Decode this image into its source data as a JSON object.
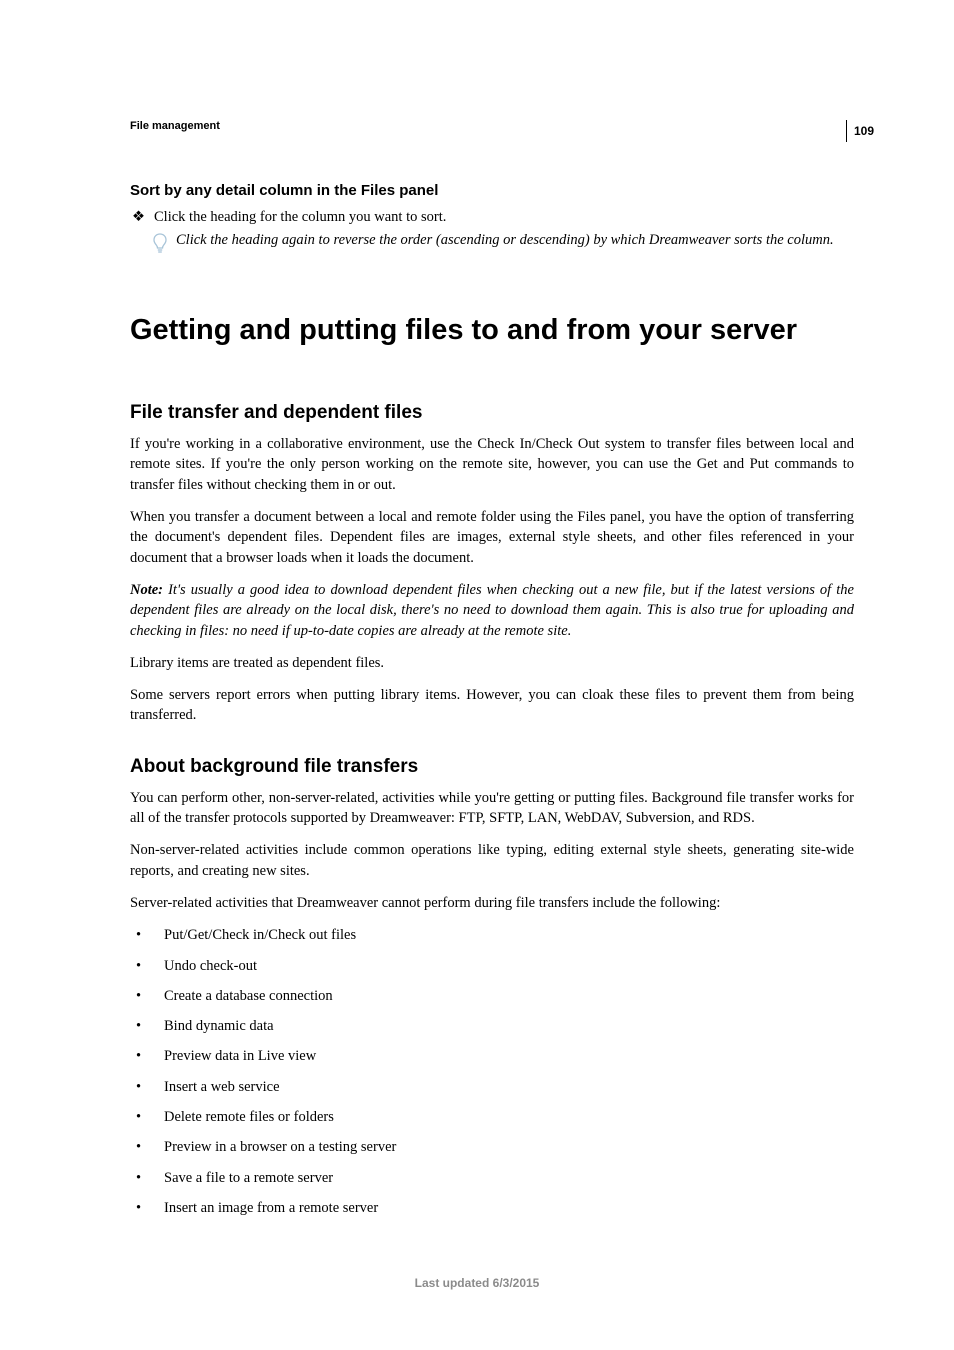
{
  "page_number": "109",
  "running_head": "File management",
  "section_sort": {
    "heading": "Sort by any detail column in the Files panel",
    "bullet": "Click the heading for the column you want to sort.",
    "tip": "Click the heading again to reverse the order (ascending or descending) by which Dreamweaver sorts the column."
  },
  "main_heading": "Getting and putting files to and from your server",
  "section_transfer": {
    "heading": "File transfer and dependent files",
    "p1": "If you're working in a collaborative environment, use the Check In/Check Out system to transfer files between local and remote sites. If you're the only person working on the remote site, however, you can use the Get and Put commands to transfer files without checking them in or out.",
    "p2": "When you transfer a document between a local and remote folder using the Files panel, you have the option of transferring the document's dependent files. Dependent files are images, external style sheets, and other files referenced in your document that a browser loads when it loads the document.",
    "note_label": "Note: ",
    "note_text": "It's usually a good idea to download dependent files when checking out a new file, but if the latest versions of the dependent files are already on the local disk, there's no need to download them again. This is also true for uploading and checking in files: no need if up-to-date copies are already at the remote site.",
    "p3": "Library items are treated as dependent files.",
    "p4": "Some servers report errors when putting library items. However, you can cloak these files to prevent them from being transferred."
  },
  "section_background": {
    "heading": "About background file transfers",
    "p1": "You can perform other, non-server-related, activities while you're getting or putting files. Background file transfer works for all of the transfer protocols supported by Dreamweaver: FTP, SFTP, LAN, WebDAV, Subversion, and RDS.",
    "p2": "Non-server-related activities include common operations like typing, editing external style sheets, generating site-wide reports, and creating new sites.",
    "p3": "Server-related activities that Dreamweaver cannot perform during file transfers include the following:",
    "items": [
      "Put/Get/Check in/Check out files",
      "Undo check-out",
      "Create a database connection",
      "Bind dynamic data",
      "Preview data in Live view",
      "Insert a web service",
      "Delete remote files or folders",
      "Preview in a browser on a testing server",
      "Save a file to a remote server",
      "Insert an image from a remote server"
    ]
  },
  "footer": "Last updated 6/3/2015"
}
